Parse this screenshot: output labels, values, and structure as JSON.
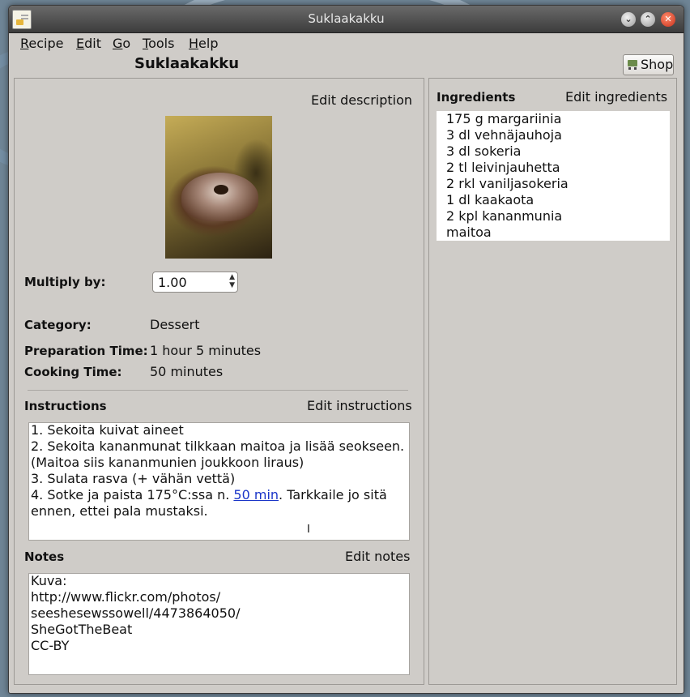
{
  "window": {
    "title": "Suklaakakku"
  },
  "menubar": {
    "items": [
      {
        "label": "Recipe",
        "mnemonic": "R"
      },
      {
        "label": "Edit",
        "mnemonic": "E"
      },
      {
        "label": "Go",
        "mnemonic": "G"
      },
      {
        "label": "Tools",
        "mnemonic": "T"
      },
      {
        "label": "Help",
        "mnemonic": "H"
      }
    ]
  },
  "header": {
    "recipe_title": "Suklaakakku",
    "shop_label": "Shop",
    "shop_icon": "shopping-cart-icon"
  },
  "description": {
    "edit_label": "Edit description",
    "multiply_label": "Multiply by:",
    "multiply_value": "1.00",
    "category_label": "Category:",
    "category_value": "Dessert",
    "prep_label": "Preparation Time:",
    "prep_value": "1 hour 5 minutes",
    "cook_label": "Cooking Time:",
    "cook_value": "50 minutes"
  },
  "instructions": {
    "heading": "Instructions",
    "edit_label": "Edit instructions",
    "lines": [
      "1. Sekoita kuivat aineet",
      "2. Sekoita kananmunat tilkkaan maitoa ja lisää seokseen.",
      "(Maitoa siis kananmunien joukkoon liraus)",
      "3. Sulata rasva (+ vähän vettä)"
    ],
    "line4_before": "4. Sotke ja paista 175°C:ssa n. ",
    "line4_link": "50 min",
    "line4_after": ". Tarkkaile jo sitä",
    "line5": "ennen, ettei pala mustaksi."
  },
  "notes": {
    "heading": "Notes",
    "edit_label": "Edit notes",
    "lines": [
      "Kuva:",
      "http://www.flickr.com/photos/",
      "seeshesewssowell/4473864050/",
      "SheGotTheBeat",
      "CC-BY"
    ]
  },
  "ingredients": {
    "heading": "Ingredients",
    "edit_label": "Edit ingredients",
    "items": [
      "175 g margariinia",
      "3 dl vehnäjauhoja",
      "3 dl sokeria",
      "2 tl leivinjauhetta",
      "2 rkl vaniljasokeria",
      "1 dl kaakaota",
      "2 kpl kananmunia",
      "maitoa"
    ]
  }
}
